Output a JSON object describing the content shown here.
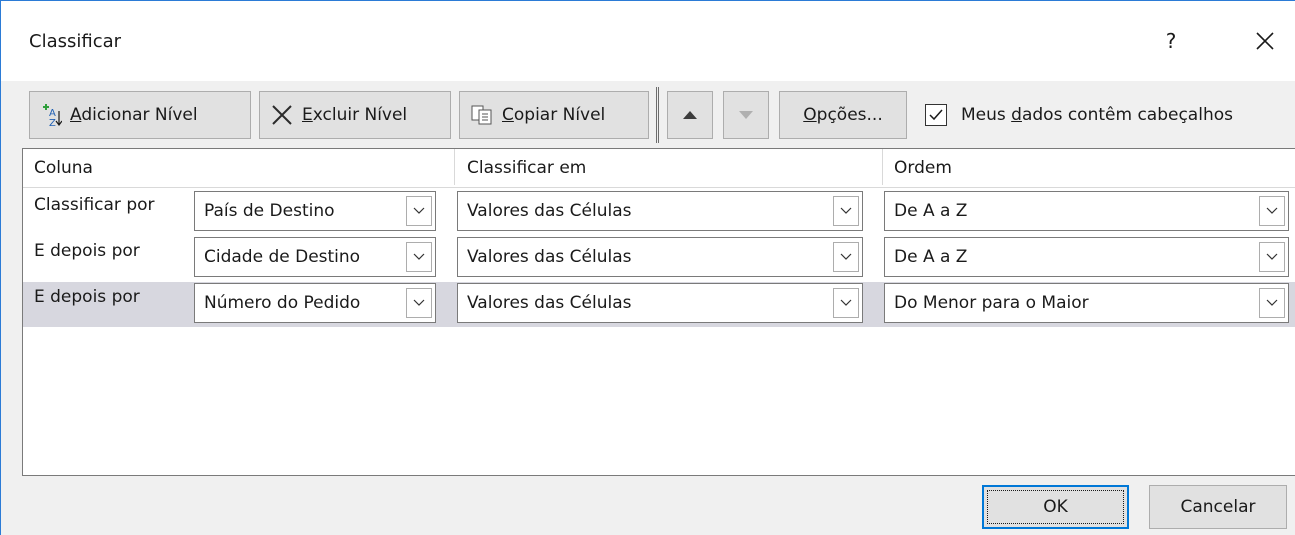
{
  "window": {
    "title": "Classificar",
    "help_glyph": "?"
  },
  "toolbar": {
    "add_level": {
      "accel": "A",
      "rest": "dicionar Nível"
    },
    "delete_level": {
      "accel": "E",
      "rest": "xcluir Nível"
    },
    "copy_level": {
      "accel": "C",
      "rest": "opiar Nível"
    },
    "options": {
      "accel": "O",
      "rest": "pções..."
    },
    "move_up_icon": "triangle-up-icon",
    "move_down_icon": "triangle-down-icon",
    "has_headers": {
      "before": "Meus ",
      "accel": "d",
      "after": "ados contêm cabeçalhos",
      "checked": true
    }
  },
  "columns": {
    "column": "Coluna",
    "sort_on": "Classificar em",
    "order": "Ordem"
  },
  "levels": [
    {
      "label": "Classificar por",
      "column": "País de Destino",
      "sort_on": "Valores das Células",
      "order": "De A a Z",
      "selected": false
    },
    {
      "label": "E depois por",
      "column": "Cidade de Destino",
      "sort_on": "Valores das Células",
      "order": "De A a Z",
      "selected": false
    },
    {
      "label": "E depois por",
      "column": "Número do Pedido",
      "sort_on": "Valores das Células",
      "order": "Do Menor para o Maior",
      "selected": true
    }
  ],
  "buttons": {
    "ok": "OK",
    "cancel": "Cancelar"
  },
  "colors": {
    "accent": "#0078d7",
    "selected_row": "#d7d7df"
  }
}
